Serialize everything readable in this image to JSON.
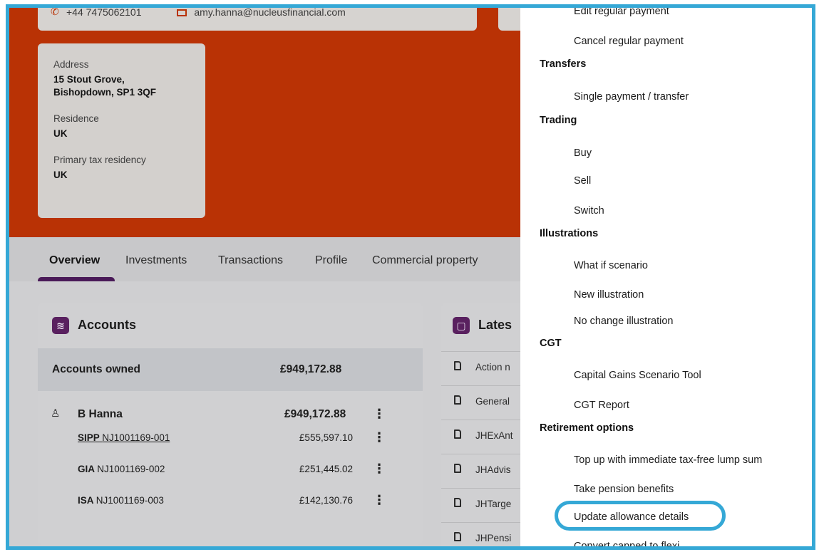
{
  "contact": {
    "phone": "+44 7475062101",
    "email": "amy.hanna@nucleusfinancial.com"
  },
  "address": {
    "address_label": "Address",
    "address_line1": "15 Stout Grove,",
    "address_line2": "Bishopdown, SP1 3QF",
    "residence_label": "Residence",
    "residence_value": "UK",
    "tax_label": "Primary tax residency",
    "tax_value": "UK"
  },
  "tabs": [
    "Overview",
    "Investments",
    "Transactions",
    "Profile",
    "Commercial property"
  ],
  "accounts": {
    "title": "Accounts",
    "owned_label": "Accounts owned",
    "owned_total": "£949,172.88",
    "person": {
      "name": "B Hanna",
      "total": "£949,172.88"
    },
    "rows": [
      {
        "type": "SIPP",
        "id": "NJ1001169-001",
        "amount": "£555,597.10"
      },
      {
        "type": "GIA",
        "id": "NJ1001169-002",
        "amount": "£251,445.02"
      },
      {
        "type": "ISA",
        "id": "NJ1001169-003",
        "amount": "£142,130.76"
      }
    ]
  },
  "latest": {
    "title": "Lates",
    "docs": [
      "Action n",
      "General",
      "JHExAnt",
      "JHAdvis",
      "JHTarge",
      "JHPensi"
    ]
  },
  "menu": {
    "items_top": [
      "Edit regular payment",
      "Cancel regular payment"
    ],
    "transfers": {
      "heading": "Transfers",
      "items": [
        "Single payment / transfer"
      ]
    },
    "trading": {
      "heading": "Trading",
      "items": [
        "Buy",
        "Sell",
        "Switch"
      ]
    },
    "illustrations": {
      "heading": "Illustrations",
      "items": [
        "What if scenario",
        "New illustration",
        "No change illustration"
      ]
    },
    "cgt": {
      "heading": "CGT",
      "items": [
        "Capital Gains Scenario Tool",
        "CGT Report"
      ]
    },
    "retirement": {
      "heading": "Retirement options",
      "items": [
        "Top up with immediate tax-free lump sum",
        "Take pension benefits",
        "Update allowance details",
        "Convert capped to flexi"
      ]
    }
  },
  "colors": {
    "hero": "#b93205",
    "highlight": "#35a8d6",
    "badge": "#59205f"
  }
}
